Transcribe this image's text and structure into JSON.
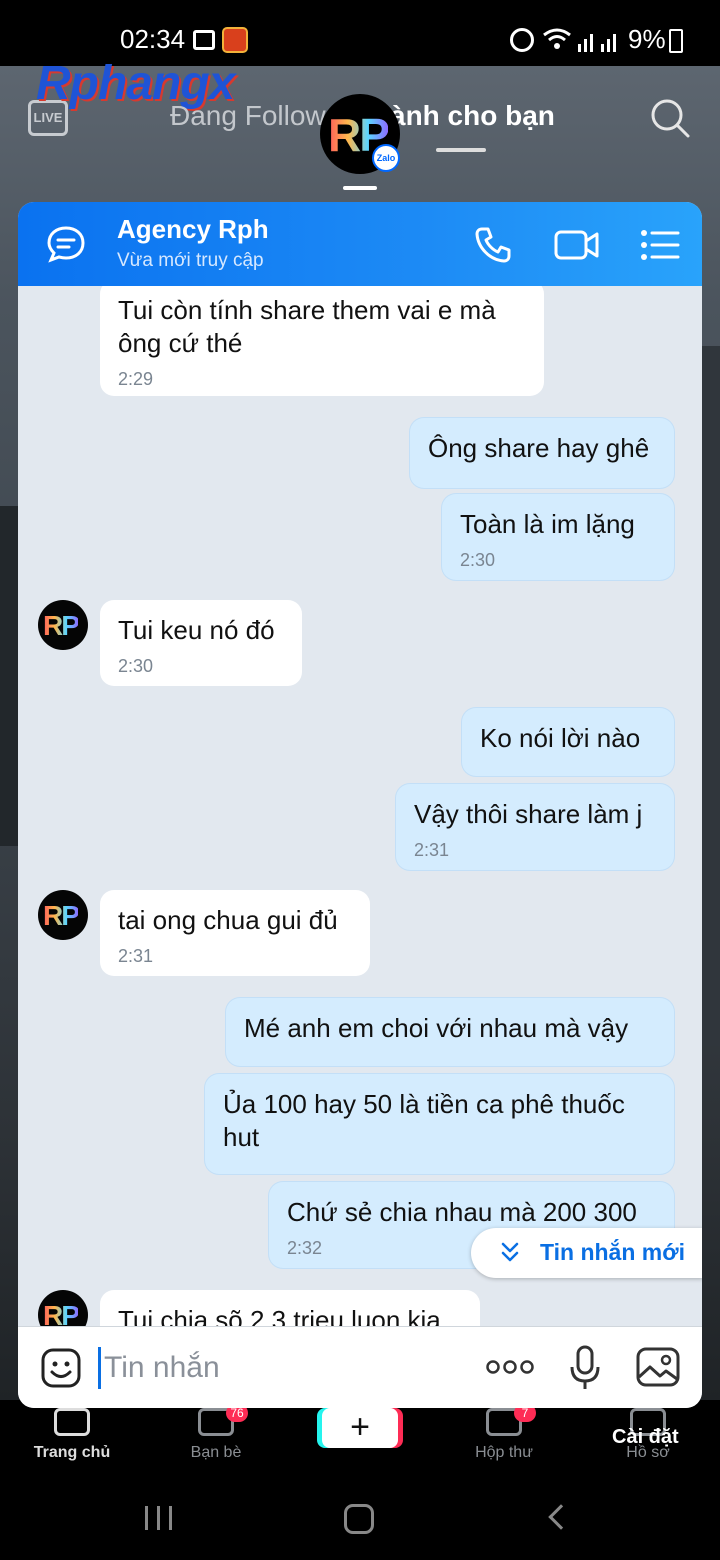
{
  "status_bar": {
    "time": "02:34",
    "battery": "9%"
  },
  "tiktok": {
    "watermark": "Rphangx",
    "live_label": "LIVE",
    "tab_following": "Đang Follow",
    "tab_for_you": "ành cho bạn",
    "chat_head_avatar": "RP",
    "zalo_badge": "Zalo",
    "nav": {
      "home": "Trang chủ",
      "friends": "Bạn bè",
      "friends_badge": "76",
      "create": "+",
      "inbox": "Hộp thư",
      "inbox_badge": "7",
      "profile": "Hồ sơ",
      "settings": "Cài đặt"
    }
  },
  "chat": {
    "contact_name": "Agency Rph",
    "contact_status": "Vừa mới truy cập",
    "avatar_text": "RP",
    "messages": [
      {
        "dir": "in",
        "text": "Tui còn tính share them vai e mà ông cứ thé",
        "time": "2:29"
      },
      {
        "dir": "out",
        "text": "Ông share hay ghê",
        "time": ""
      },
      {
        "dir": "out",
        "text": "Toàn là im lặng",
        "time": "2:30"
      },
      {
        "dir": "in",
        "text": "Tui keu nó đó",
        "time": "2:30"
      },
      {
        "dir": "out",
        "text": "Ko nói lời nào",
        "time": ""
      },
      {
        "dir": "out",
        "text": "Vậy thôi share làm j",
        "time": "2:31"
      },
      {
        "dir": "in",
        "text": "tai ong chua gui đủ",
        "time": "2:31"
      },
      {
        "dir": "out",
        "text": "Mé anh em choi với nhau mà vậy",
        "time": ""
      },
      {
        "dir": "out",
        "text": "Ủa 100 hay 50 là tiền ca phê thuốc hut",
        "time": ""
      },
      {
        "dir": "out",
        "text": "Chứ sẻ chia nhau mà 200 300",
        "time": "2:32"
      },
      {
        "dir": "in",
        "text": "Tui chia sõ 2.3 trieu luon kia",
        "time": ""
      }
    ],
    "new_messages_label": "Tin nhắn mới",
    "input_placeholder": "Tin nhắn"
  },
  "colors": {
    "zalo_blue": "#0a72f0",
    "outgoing_bubble": "#d4ecfe",
    "chat_bg": "#e2e8ef"
  }
}
